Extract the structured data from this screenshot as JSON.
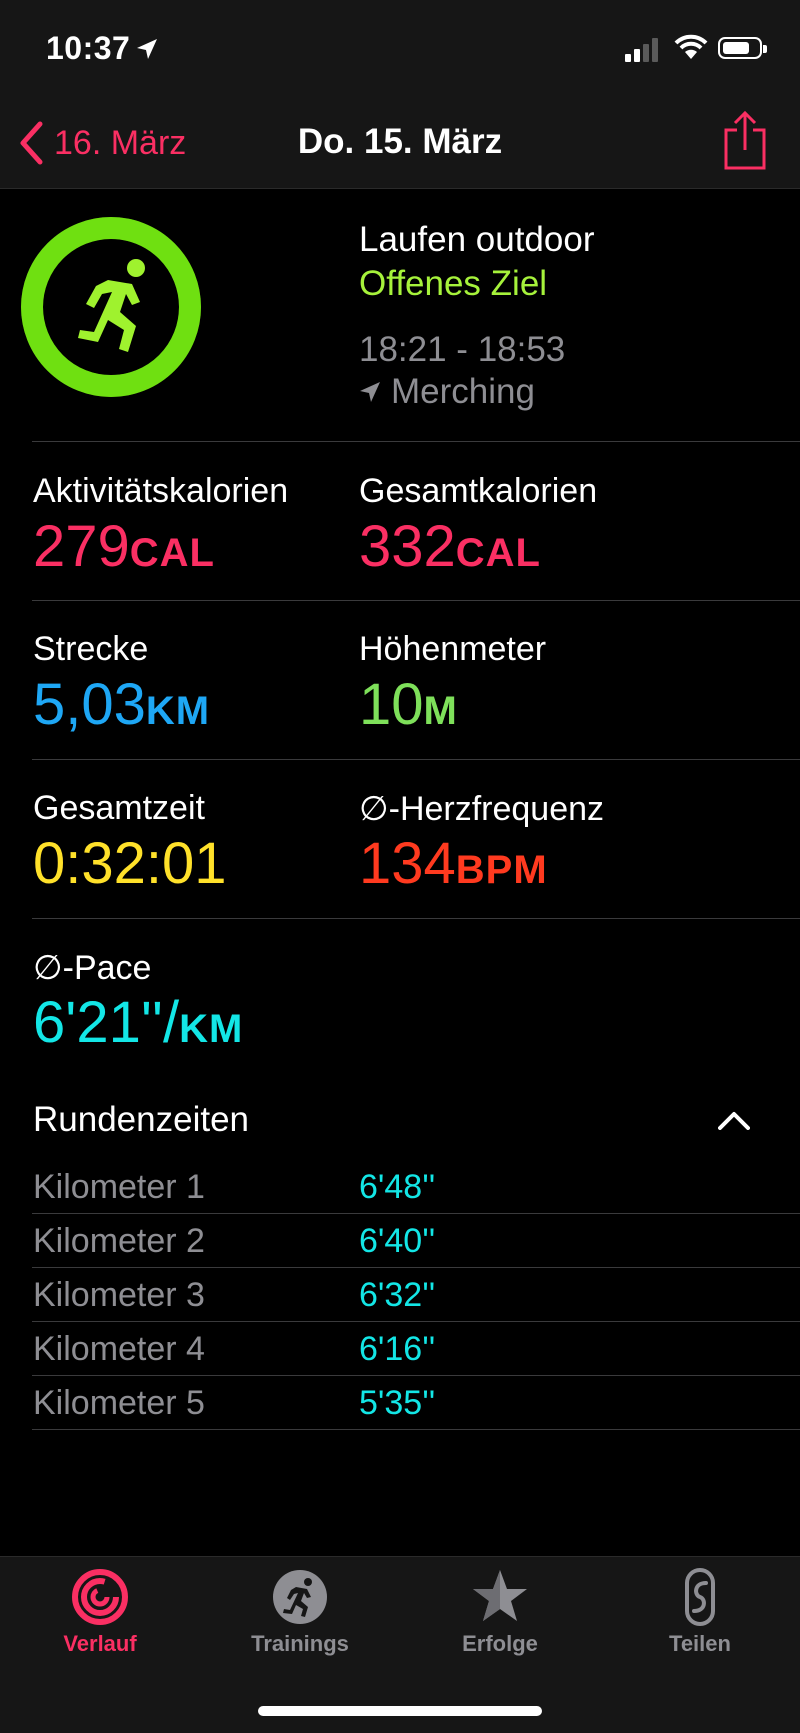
{
  "status": {
    "time": "10:37"
  },
  "nav": {
    "back_label": "16. März",
    "title": "Do. 15. März"
  },
  "workout": {
    "type": "Laufen outdoor",
    "goal": "Offenes Ziel",
    "time_range": "18:21 - 18:53",
    "location": "Merching"
  },
  "metrics": {
    "active_cal": {
      "label": "Aktivitätskalorien",
      "value": "279",
      "unit": "CAL",
      "color": "#fa2f63"
    },
    "total_cal": {
      "label": "Gesamtkalorien",
      "value": "332",
      "unit": "CAL",
      "color": "#fa2f63"
    },
    "distance": {
      "label": "Strecke",
      "value": "5,03",
      "unit": "KM",
      "color": "#1ea7f5"
    },
    "elevation": {
      "label": "Höhenmeter",
      "value": "10",
      "unit": "M",
      "color": "#7ee05a"
    },
    "total_time": {
      "label": "Gesamtzeit",
      "value": "0:32:01",
      "unit": "",
      "color": "#ffe12a"
    },
    "heart_rate": {
      "label": "∅-Herzfrequenz",
      "value": "134",
      "unit": "BPM",
      "color": "#ff3a1f"
    },
    "pace": {
      "label": "∅-Pace",
      "value": "6'21''/",
      "unit": "KM",
      "color": "#13e6e6"
    }
  },
  "laps": {
    "title": "Rundenzeiten",
    "items": [
      {
        "name": "Kilometer 1",
        "time": "6'48''"
      },
      {
        "name": "Kilometer 2",
        "time": "6'40''"
      },
      {
        "name": "Kilometer 3",
        "time": "6'32''"
      },
      {
        "name": "Kilometer 4",
        "time": "6'16''"
      },
      {
        "name": "Kilometer 5",
        "time": "5'35''"
      }
    ]
  },
  "tabs": [
    {
      "label": "Verlauf",
      "icon": "history-rings-icon",
      "active": true
    },
    {
      "label": "Trainings",
      "icon": "running-figure-icon",
      "active": false
    },
    {
      "label": "Erfolge",
      "icon": "awards-star-icon",
      "active": false
    },
    {
      "label": "Teilen",
      "icon": "sharing-icon",
      "active": false
    }
  ],
  "colors": {
    "accent": "#fa2f63",
    "goal": "#a6f23b",
    "secondary_text": "#8e8e93"
  }
}
